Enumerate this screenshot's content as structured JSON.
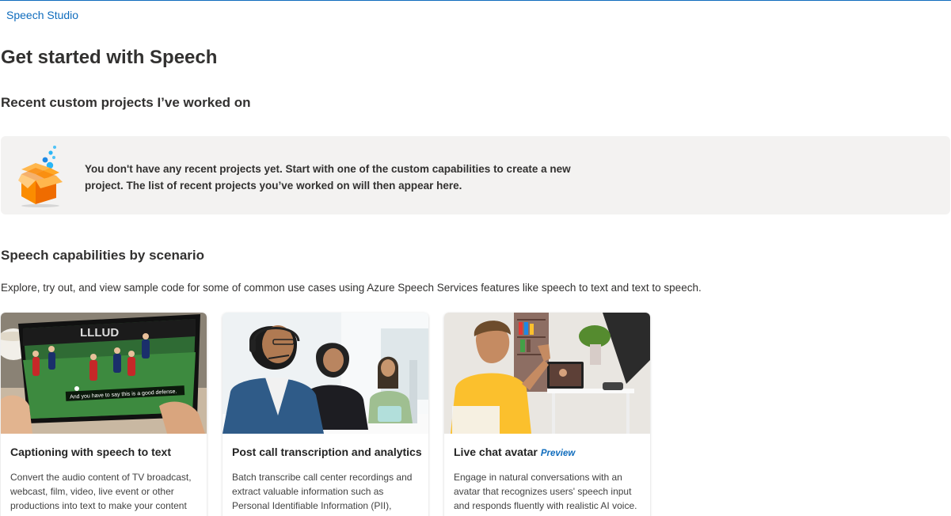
{
  "breadcrumb": {
    "label": "Speech Studio"
  },
  "page": {
    "title": "Get started with Speech"
  },
  "recent": {
    "title": "Recent custom projects I’ve worked on",
    "empty_text": "You don't have any recent projects yet. Start with one of the custom capabilities to create a new project. The list of recent projects you’ve worked on will then appear here.",
    "icon": "open-box-icon"
  },
  "scenarios": {
    "title": "Speech capabilities by scenario",
    "intro": "Explore, try out, and view sample code for some of common use cases using Azure Speech Services features like speech to text and text to speech.",
    "cards": [
      {
        "title": "Captioning with speech to text",
        "badge": "",
        "caption_in_image": "And you have to say this is a good defense.",
        "scoreboard_text": "LLLUD",
        "description": "Convert the audio content of TV broadcast, webcast, film, video, live event or other productions into text to make your content"
      },
      {
        "title": "Post call transcription and analytics",
        "badge": "",
        "description": "Batch transcribe call center recordings and extract valuable information such as Personal Identifiable Information (PII),"
      },
      {
        "title": "Live chat avatar",
        "badge": "Preview",
        "description": "Engage in natural conversations with an avatar that recognizes users' speech input and responds fluently with realistic AI voice."
      }
    ]
  },
  "colors": {
    "link": "#0f6cbd",
    "panel": "#f3f2f1",
    "text": "#323130"
  }
}
